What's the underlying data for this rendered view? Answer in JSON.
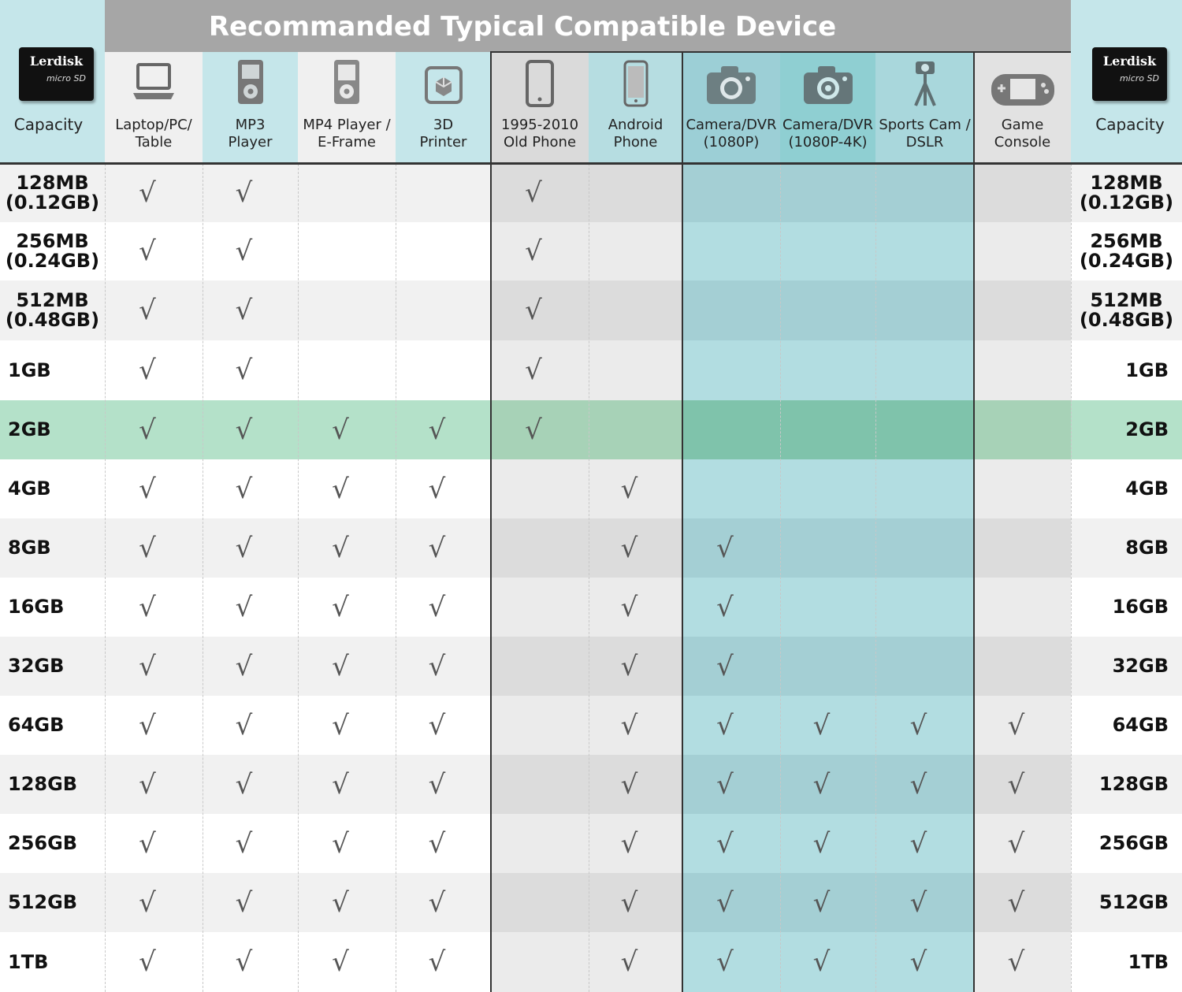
{
  "banner_title": "Recommanded Typical Compatible Device",
  "capacity_header": "Capacity",
  "brand": "Lerdisk",
  "card_mark": "micro SD",
  "colors": {
    "header_bg": "#c5e6ea",
    "banner_bg": "#a6a6a6",
    "row_highlight": "#b4e1c9",
    "teal_band": "#a9d7dc",
    "gray_band": "#e3e3e3",
    "check": "#555555"
  },
  "devices": [
    {
      "label": "Laptop/PC/\nTable",
      "icon": "laptop-icon"
    },
    {
      "label": "MP3\nPlayer",
      "icon": "mp3-player-icon"
    },
    {
      "label": "MP4 Player /\nE-Frame",
      "icon": "mp4-player-icon"
    },
    {
      "label": "3D\nPrinter",
      "icon": "3d-printer-icon"
    },
    {
      "label": "1995-2010\nOld Phone",
      "icon": "old-phone-icon"
    },
    {
      "label": "Android\nPhone",
      "icon": "android-phone-icon"
    },
    {
      "label": "Camera/DVR\n(1080P)",
      "icon": "camera-icon"
    },
    {
      "label": "Camera/DVR\n(1080P-4K)",
      "icon": "camera-4k-icon"
    },
    {
      "label": "Sports Cam /\nDSLR",
      "icon": "tripod-camera-icon"
    },
    {
      "label": "Game\nConsole",
      "icon": "game-console-icon"
    }
  ],
  "check_mark": "√",
  "rows": [
    {
      "capacity": "128MB\n(0.12GB)",
      "checks": [
        1,
        1,
        0,
        0,
        1,
        0,
        0,
        0,
        0,
        0
      ]
    },
    {
      "capacity": "256MB\n(0.24GB)",
      "checks": [
        1,
        1,
        0,
        0,
        1,
        0,
        0,
        0,
        0,
        0
      ]
    },
    {
      "capacity": "512MB\n(0.48GB)",
      "checks": [
        1,
        1,
        0,
        0,
        1,
        0,
        0,
        0,
        0,
        0
      ]
    },
    {
      "capacity": "1GB",
      "checks": [
        1,
        1,
        0,
        0,
        1,
        0,
        0,
        0,
        0,
        0
      ]
    },
    {
      "capacity": "2GB",
      "checks": [
        1,
        1,
        1,
        1,
        1,
        0,
        0,
        0,
        0,
        0
      ],
      "highlight": true
    },
    {
      "capacity": "4GB",
      "checks": [
        1,
        1,
        1,
        1,
        0,
        1,
        0,
        0,
        0,
        0
      ]
    },
    {
      "capacity": "8GB",
      "checks": [
        1,
        1,
        1,
        1,
        0,
        1,
        1,
        0,
        0,
        0
      ]
    },
    {
      "capacity": "16GB",
      "checks": [
        1,
        1,
        1,
        1,
        0,
        1,
        1,
        0,
        0,
        0
      ]
    },
    {
      "capacity": "32GB",
      "checks": [
        1,
        1,
        1,
        1,
        0,
        1,
        1,
        0,
        0,
        0
      ]
    },
    {
      "capacity": "64GB",
      "checks": [
        1,
        1,
        1,
        1,
        0,
        1,
        1,
        1,
        1,
        1
      ]
    },
    {
      "capacity": "128GB",
      "checks": [
        1,
        1,
        1,
        1,
        0,
        1,
        1,
        1,
        1,
        1
      ]
    },
    {
      "capacity": "256GB",
      "checks": [
        1,
        1,
        1,
        1,
        0,
        1,
        1,
        1,
        1,
        1
      ]
    },
    {
      "capacity": "512GB",
      "checks": [
        1,
        1,
        1,
        1,
        0,
        1,
        1,
        1,
        1,
        1
      ]
    },
    {
      "capacity": "1TB",
      "checks": [
        1,
        1,
        1,
        1,
        0,
        1,
        1,
        1,
        1,
        1
      ]
    }
  ]
}
